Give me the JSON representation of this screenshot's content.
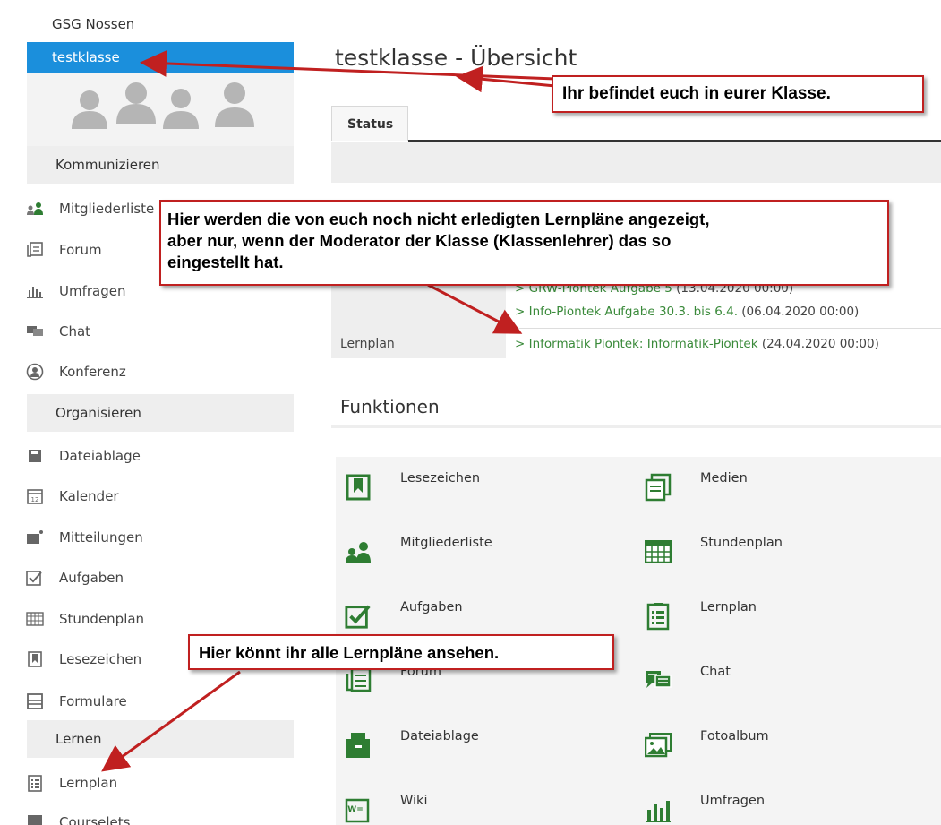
{
  "sidebar": {
    "school": "GSG Nossen",
    "class": "testklasse",
    "sections": {
      "kommunizieren": "Kommunizieren",
      "organisieren": "Organisieren",
      "lernen": "Lernen"
    },
    "items": [
      {
        "label": "Mitgliederliste",
        "icon": "members-icon"
      },
      {
        "label": "Forum",
        "icon": "forum-icon"
      },
      {
        "label": "Umfragen",
        "icon": "poll-icon"
      },
      {
        "label": "Chat",
        "icon": "chat-icon"
      },
      {
        "label": "Konferenz",
        "icon": "conference-icon"
      },
      {
        "label": "Dateiablage",
        "icon": "file-storage-icon"
      },
      {
        "label": "Kalender",
        "icon": "calendar-icon"
      },
      {
        "label": "Mitteilungen",
        "icon": "messages-icon"
      },
      {
        "label": "Aufgaben",
        "icon": "tasks-icon"
      },
      {
        "label": "Stundenplan",
        "icon": "timetable-icon"
      },
      {
        "label": "Lesezeichen",
        "icon": "bookmark-icon"
      },
      {
        "label": "Formulare",
        "icon": "forms-icon"
      },
      {
        "label": "Lernplan",
        "icon": "learning-plan-icon"
      },
      {
        "label": "Courselets",
        "icon": "courselets-icon"
      }
    ]
  },
  "main": {
    "title": "testklasse - Übersicht",
    "status_tab": "Status",
    "lernplan_label": "Lernplan",
    "lernplaene": [
      {
        "text": "> GRW-Piontek Aufgabe 5",
        "date": " (13.04.2020 00:00)"
      },
      {
        "text": "> Info-Piontek Aufgabe 30.3. bis 6.4.",
        "date": " (06.04.2020 00:00)"
      },
      {
        "text": "> Informatik Piontek: Informatik-Piontek",
        "date": " (24.04.2020 00:00)"
      }
    ],
    "functions_title": "Funktionen",
    "functions": [
      {
        "label": "Lesezeichen",
        "icon": "bookmark-icon"
      },
      {
        "label": "Medien",
        "icon": "media-icon"
      },
      {
        "label": "Mitgliederliste",
        "icon": "members-icon"
      },
      {
        "label": "Stundenplan",
        "icon": "timetable-icon"
      },
      {
        "label": "Aufgaben",
        "icon": "tasks-icon"
      },
      {
        "label": "Lernplan",
        "icon": "learning-plan-icon"
      },
      {
        "label": "Forum",
        "icon": "forum-icon"
      },
      {
        "label": "Chat",
        "icon": "chat-icon"
      },
      {
        "label": "Dateiablage",
        "icon": "file-storage-icon"
      },
      {
        "label": "Fotoalbum",
        "icon": "photo-album-icon"
      },
      {
        "label": "Wiki",
        "icon": "wiki-icon"
      },
      {
        "label": "Umfragen",
        "icon": "poll-icon"
      }
    ]
  },
  "annotations": {
    "class_note": "Ihr befindet euch in eurer Klasse.",
    "lernplan_note_1": "Hier werden die von euch noch nicht erledigten Lernpläne angezeigt,",
    "lernplan_note_2": "aber nur, wenn der Moderator der Klasse (Klassenlehrer) das so",
    "lernplan_note_3": "eingestellt hat.",
    "all_plans_note": "Hier könnt ihr alle Lernpläne ansehen."
  },
  "colors": {
    "accent": "#1b8fdc",
    "link_green": "#3a8a3a",
    "icon_green": "#2e7d32",
    "annotation_red": "#c02020"
  }
}
